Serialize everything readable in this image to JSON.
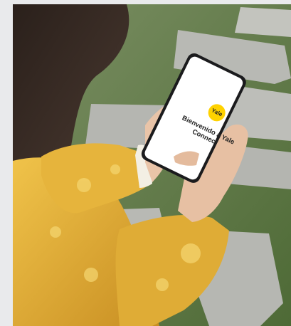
{
  "photo": {
    "phone_screen": {
      "logo_text": "Yale",
      "welcome_title": "Bienvenido a Yale Connect",
      "description": ""
    }
  },
  "colors": {
    "page_background": "#e9eaec",
    "sweater": "#e3b23a",
    "grass": "#5f7a45",
    "stone": "#b8b9b5",
    "yale_yellow": "#ffd200"
  }
}
